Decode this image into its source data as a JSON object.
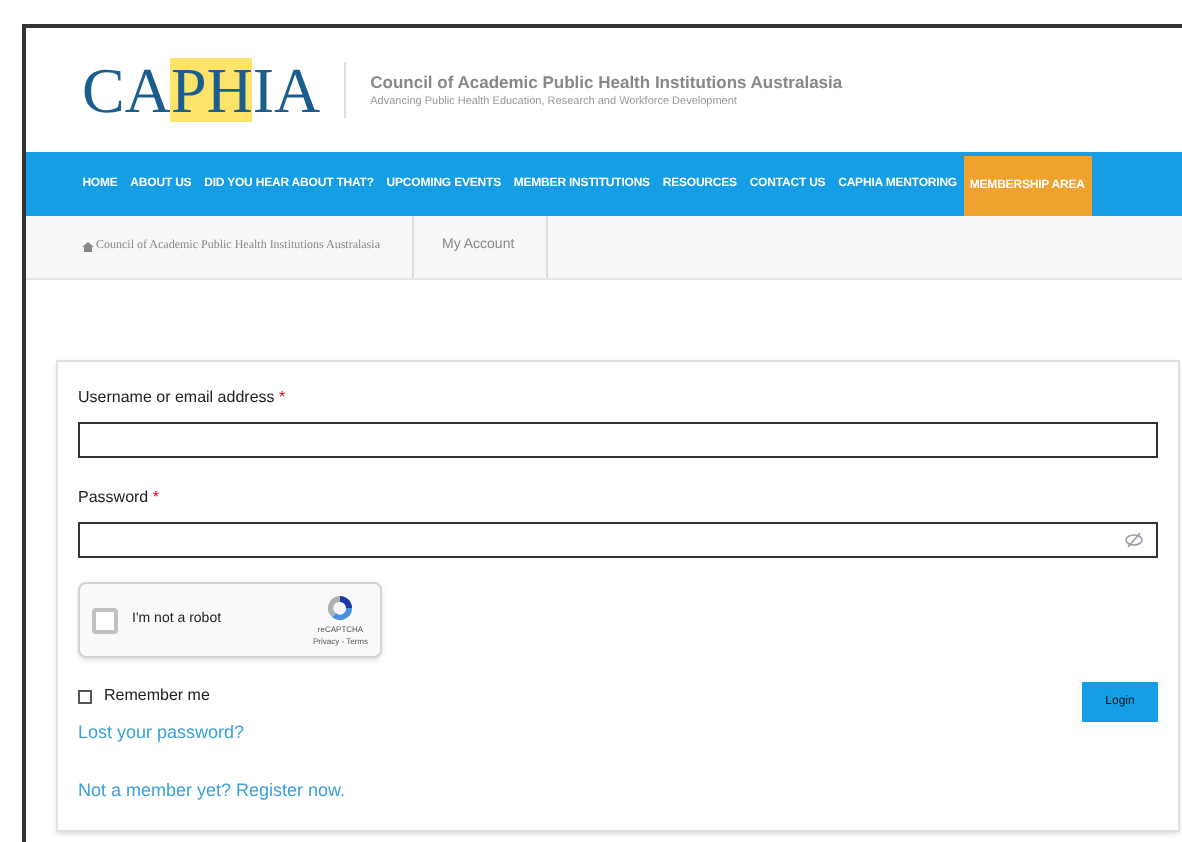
{
  "header": {
    "logo": [
      {
        "text": "CA",
        "highlighted": false
      },
      {
        "text": "PH",
        "highlighted": true
      },
      {
        "text": "IA",
        "highlighted": false
      }
    ],
    "title": "Council of Academic Public Health Institutions Australasia",
    "tagline": "Advancing Public Health Education, Research and Workforce Development"
  },
  "nav": [
    {
      "label": "HOME",
      "selected": false
    },
    {
      "label": "ABOUT US",
      "selected": false
    },
    {
      "label": "DID YOU HEAR ABOUT THAT?",
      "selected": false
    },
    {
      "label": "UPCOMING EVENTS",
      "selected": false
    },
    {
      "label": "MEMBER INSTITUTIONS",
      "selected": false
    },
    {
      "label": "RESOURCES",
      "selected": false
    },
    {
      "label": "CONTACT US",
      "selected": false
    },
    {
      "label": "CAPHIA MENTORING",
      "selected": false
    },
    {
      "label": "MEMBERSHIP AREA",
      "selected": true
    }
  ],
  "breadcrumb": [
    "Council of Academic Public Health Institutions Australasia",
    "My Account"
  ],
  "login": {
    "username_label": "Username or email address",
    "password_label": "Password",
    "required_mark": "*",
    "captcha": {
      "checked": false,
      "label": "I'm not a robot",
      "brand": "reCAPTCHA",
      "links": "Privacy - Terms"
    },
    "remember": {
      "label": "Remember me",
      "checked": false
    },
    "button": "Login",
    "lost_password": "Lost your password?",
    "register": "Not a member yet? Register now."
  }
}
